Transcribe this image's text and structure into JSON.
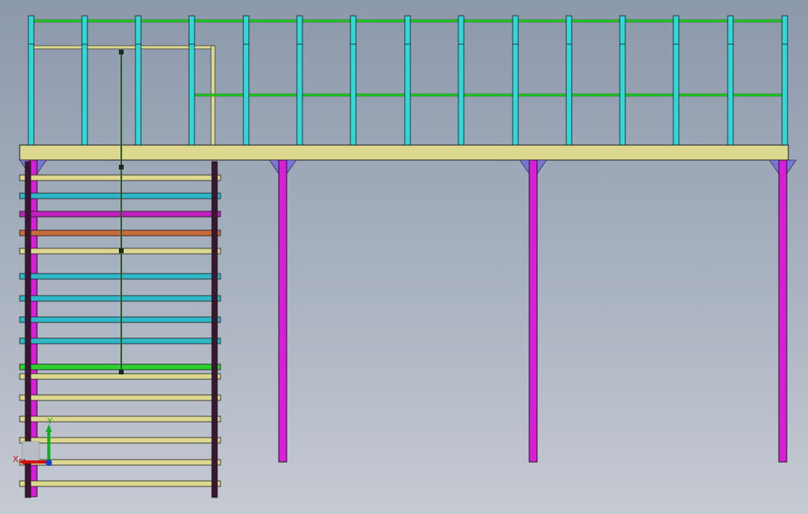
{
  "viewport": {
    "background_top": "#8c99ab",
    "background_bottom": "#c6cad3"
  },
  "model": {
    "name": "steel-platform-with-stair",
    "colors": {
      "deck": "#dcd890",
      "post": "#2fd9d9",
      "rail": "#22cc22",
      "column": "#d81ed8",
      "bracket": "#7a74d8",
      "frame": "#dcd890",
      "stringer": "#3a1630",
      "tread_default": "#dcd890",
      "tread_cyan": "#2fb8c8",
      "tread_magenta": "#c020c0",
      "tread_orange": "#c86a3a",
      "tread_green": "#30d030",
      "hanger": "#2a5a2a",
      "outline": "#1a1a1a"
    },
    "treads": [
      {
        "color": "tread_default"
      },
      {
        "color": "tread_cyan"
      },
      {
        "color": "tread_magenta"
      },
      {
        "color": "tread_orange"
      },
      {
        "color": "tread_default"
      },
      {
        "color": "tread_cyan"
      },
      {
        "color": "tread_cyan"
      },
      {
        "color": "tread_cyan"
      },
      {
        "color": "tread_cyan"
      },
      {
        "color": "tread_green"
      },
      {
        "color": "tread_default"
      },
      {
        "color": "tread_default"
      },
      {
        "color": "tread_default"
      },
      {
        "color": "tread_default"
      },
      {
        "color": "tread_default"
      },
      {
        "color": "tread_default"
      }
    ]
  },
  "triad": {
    "x_label": "X",
    "y_label": "Y",
    "x_color": "#d01010",
    "y_color": "#10b020",
    "z_color": "#1040d0"
  }
}
